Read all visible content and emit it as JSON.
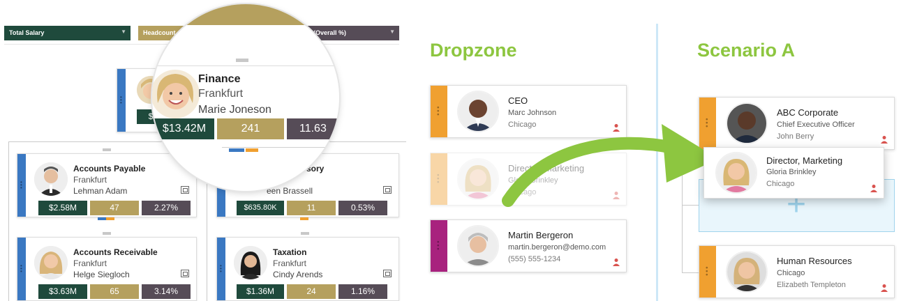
{
  "colors": {
    "salary": "#1f4a3c",
    "headcount": "#b5a05e",
    "overall": "#564c57",
    "finance_blue": "#3a78c2",
    "orange": "#f0a030",
    "magenta": "#a8227e",
    "green_heading": "#8dc640",
    "drop_light_blue": "#e9f6fc"
  },
  "toolbar": {
    "salary_label": "Total Salary",
    "headcount_label": "Headcount",
    "overall_label": "(Overall %)"
  },
  "magnifier": {
    "department": "Finance",
    "city": "Frankfurt",
    "person": "Marie Joneson",
    "salary": "$13.42M",
    "headcount": "241",
    "overall": "11.63"
  },
  "org": {
    "nodes": [
      {
        "title": "Accounts Payable",
        "city": "Frankfurt",
        "person": "Lehman Adam",
        "salary": "$2.58M",
        "headcount": "47",
        "overall": "2.27%"
      },
      {
        "title": "sory",
        "person": "een Brassell",
        "salary": "$635.80K",
        "headcount": "11",
        "overall": "0.53%"
      },
      {
        "title": "Accounts Receivable",
        "city": "Frankfurt",
        "person": "Helge Siegloch",
        "salary": "$3.63M",
        "headcount": "65",
        "overall": "3.14%"
      },
      {
        "title": "Taxation",
        "city": "Frankfurt",
        "person": "Cindy Arends",
        "salary": "$1.36M",
        "headcount": "24",
        "overall": "1.16%"
      }
    ],
    "finance_partial": {
      "salary": "$"
    }
  },
  "dropzone": {
    "heading": "Dropzone",
    "cards": [
      {
        "title": "CEO",
        "name": "Marc Johnson",
        "city": "Chicago",
        "accent": "#f0a030"
      },
      {
        "title": "Director, Marketing",
        "name": "Gloria Brinkley",
        "city": "Chicago",
        "accent": "#f0a030"
      },
      {
        "title": "Martin Bergeron",
        "name": "martin.bergeron@demo.com",
        "city": "(555) 555-1234",
        "accent": "#a8227e"
      }
    ]
  },
  "scenario": {
    "heading": "Scenario A",
    "cards": [
      {
        "title": "ABC Corporate",
        "name": "Chief Executive Officer",
        "city": "John Berry"
      },
      {
        "title": "Director, Marketing",
        "name": "Gloria Brinkley",
        "city": "Chicago"
      },
      {
        "title": "Human Resources",
        "name": "Chicago",
        "city": "Elizabeth Templeton"
      }
    ],
    "plus": "+"
  }
}
